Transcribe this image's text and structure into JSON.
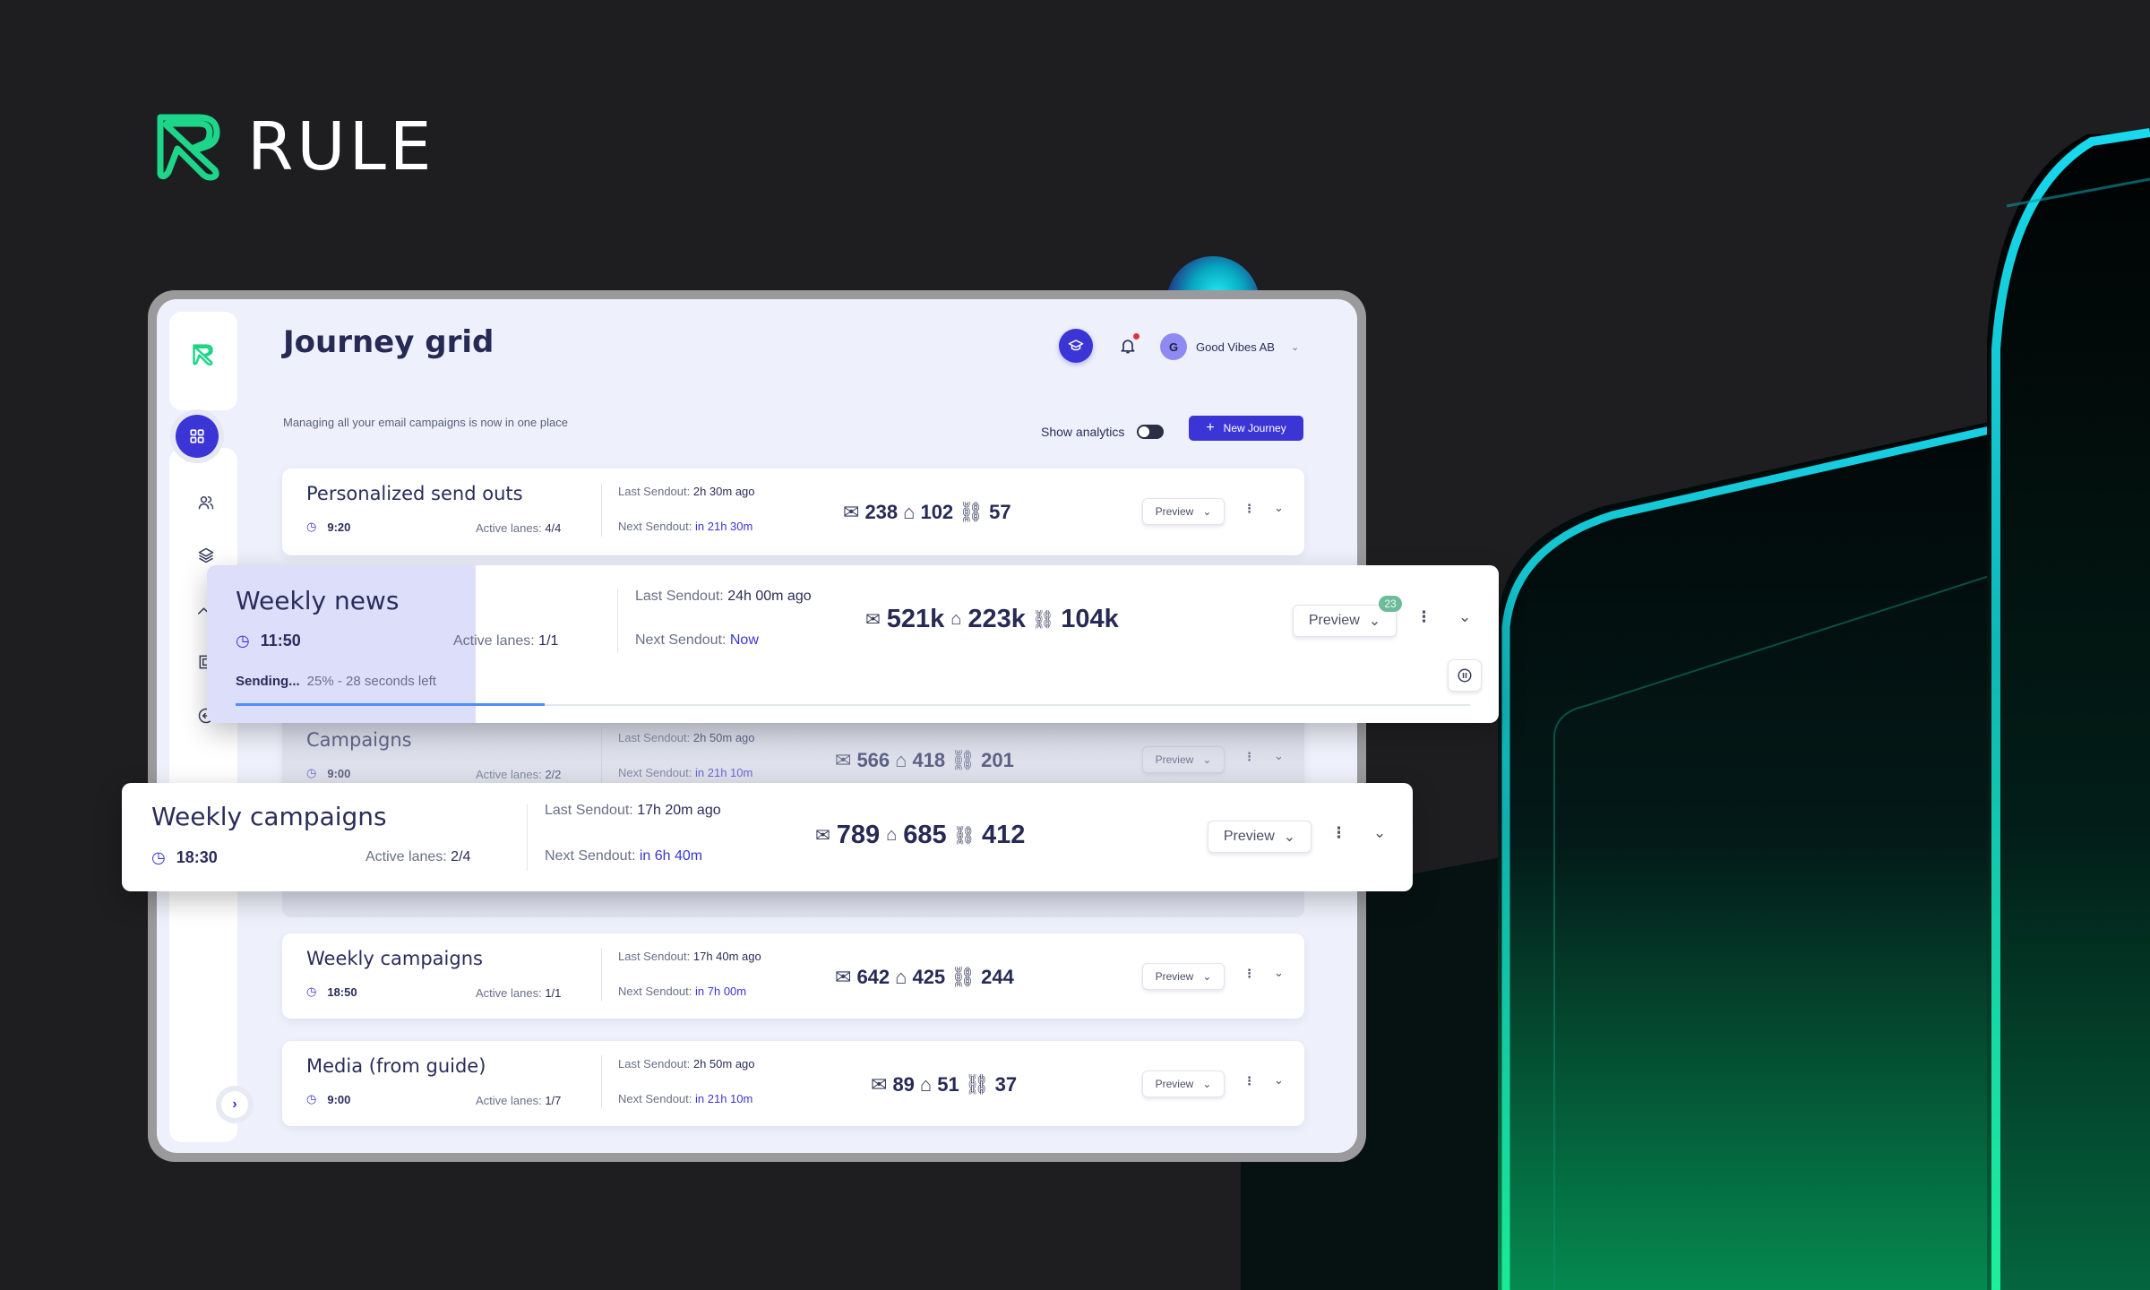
{
  "brand": {
    "name": "RULE",
    "accent": "#1ed68a"
  },
  "app": {
    "title": "Journey grid",
    "subtitle": "Managing all your email campaigns is now in one place",
    "accent": "#3b35d6",
    "header": {
      "academy_icon": "graduation-cap-icon",
      "notifications_icon": "bell-icon",
      "notification_dot": true,
      "user": {
        "initial": "G",
        "name": "Good Vibes AB"
      }
    },
    "show_analytics": {
      "label": "Show analytics",
      "enabled": false
    },
    "new_journey_label": "New Journey",
    "sidebar": {
      "items": [
        {
          "name": "journey-grid",
          "icon": "grid-icon",
          "active": true
        },
        {
          "name": "contacts",
          "icon": "users-icon",
          "active": false
        },
        {
          "name": "templates",
          "icon": "layers-icon",
          "active": false
        },
        {
          "name": "analytics",
          "icon": "trending-up-icon",
          "active": false
        },
        {
          "name": "frame",
          "icon": "frame-icon",
          "active": false
        },
        {
          "name": "back",
          "icon": "arrow-left-circle-icon",
          "active": false
        }
      ],
      "collapse_icon": "chevron-right-icon"
    },
    "labels": {
      "last_sendout": "Last Sendout:",
      "next_sendout": "Next Sendout:",
      "active_lanes": "Active lanes:",
      "preview": "Preview",
      "sending": "Sending..."
    },
    "journeys": [
      {
        "name": "Personalized send outs",
        "time": "9:20",
        "active_lanes": "4/4",
        "last_sendout": "2h 30m ago",
        "next_sendout": "in 21h 30m",
        "sent": "238",
        "opened": "102",
        "clicked": "57"
      },
      {
        "name": "Weekly news",
        "time": "11:50",
        "active_lanes": "1/1",
        "last_sendout": "24h 00m ago",
        "next_sendout": "Now",
        "sent": "521k",
        "opened": "223k",
        "clicked": "104k",
        "preview_badge": "23",
        "sending_progress_pct": 25,
        "sending_status": "25% - 28 seconds left"
      },
      {
        "name": "Campaigns",
        "time": "9:00",
        "active_lanes": "2/2",
        "last_sendout": "2h 50m ago",
        "next_sendout": "in 21h 10m",
        "sent": "566",
        "opened": "418",
        "clicked": "201"
      },
      {
        "name": "Weekly campaigns",
        "time": "18:30",
        "active_lanes": "2/4",
        "last_sendout": "17h 20m ago",
        "next_sendout": "in 6h 40m",
        "sent": "789",
        "opened": "685",
        "clicked": "412"
      },
      {
        "name": "Weekly campaigns",
        "time": "18:50",
        "active_lanes": "1/1",
        "last_sendout": "17h 40m ago",
        "next_sendout": "in 7h 00m",
        "sent": "642",
        "opened": "425",
        "clicked": "244"
      },
      {
        "name": "Media (from guide)",
        "time": "9:00",
        "active_lanes": "1/7",
        "last_sendout": "2h 50m ago",
        "next_sendout": "in 21h 10m",
        "sent": "89",
        "opened": "51",
        "clicked": "37"
      }
    ]
  }
}
